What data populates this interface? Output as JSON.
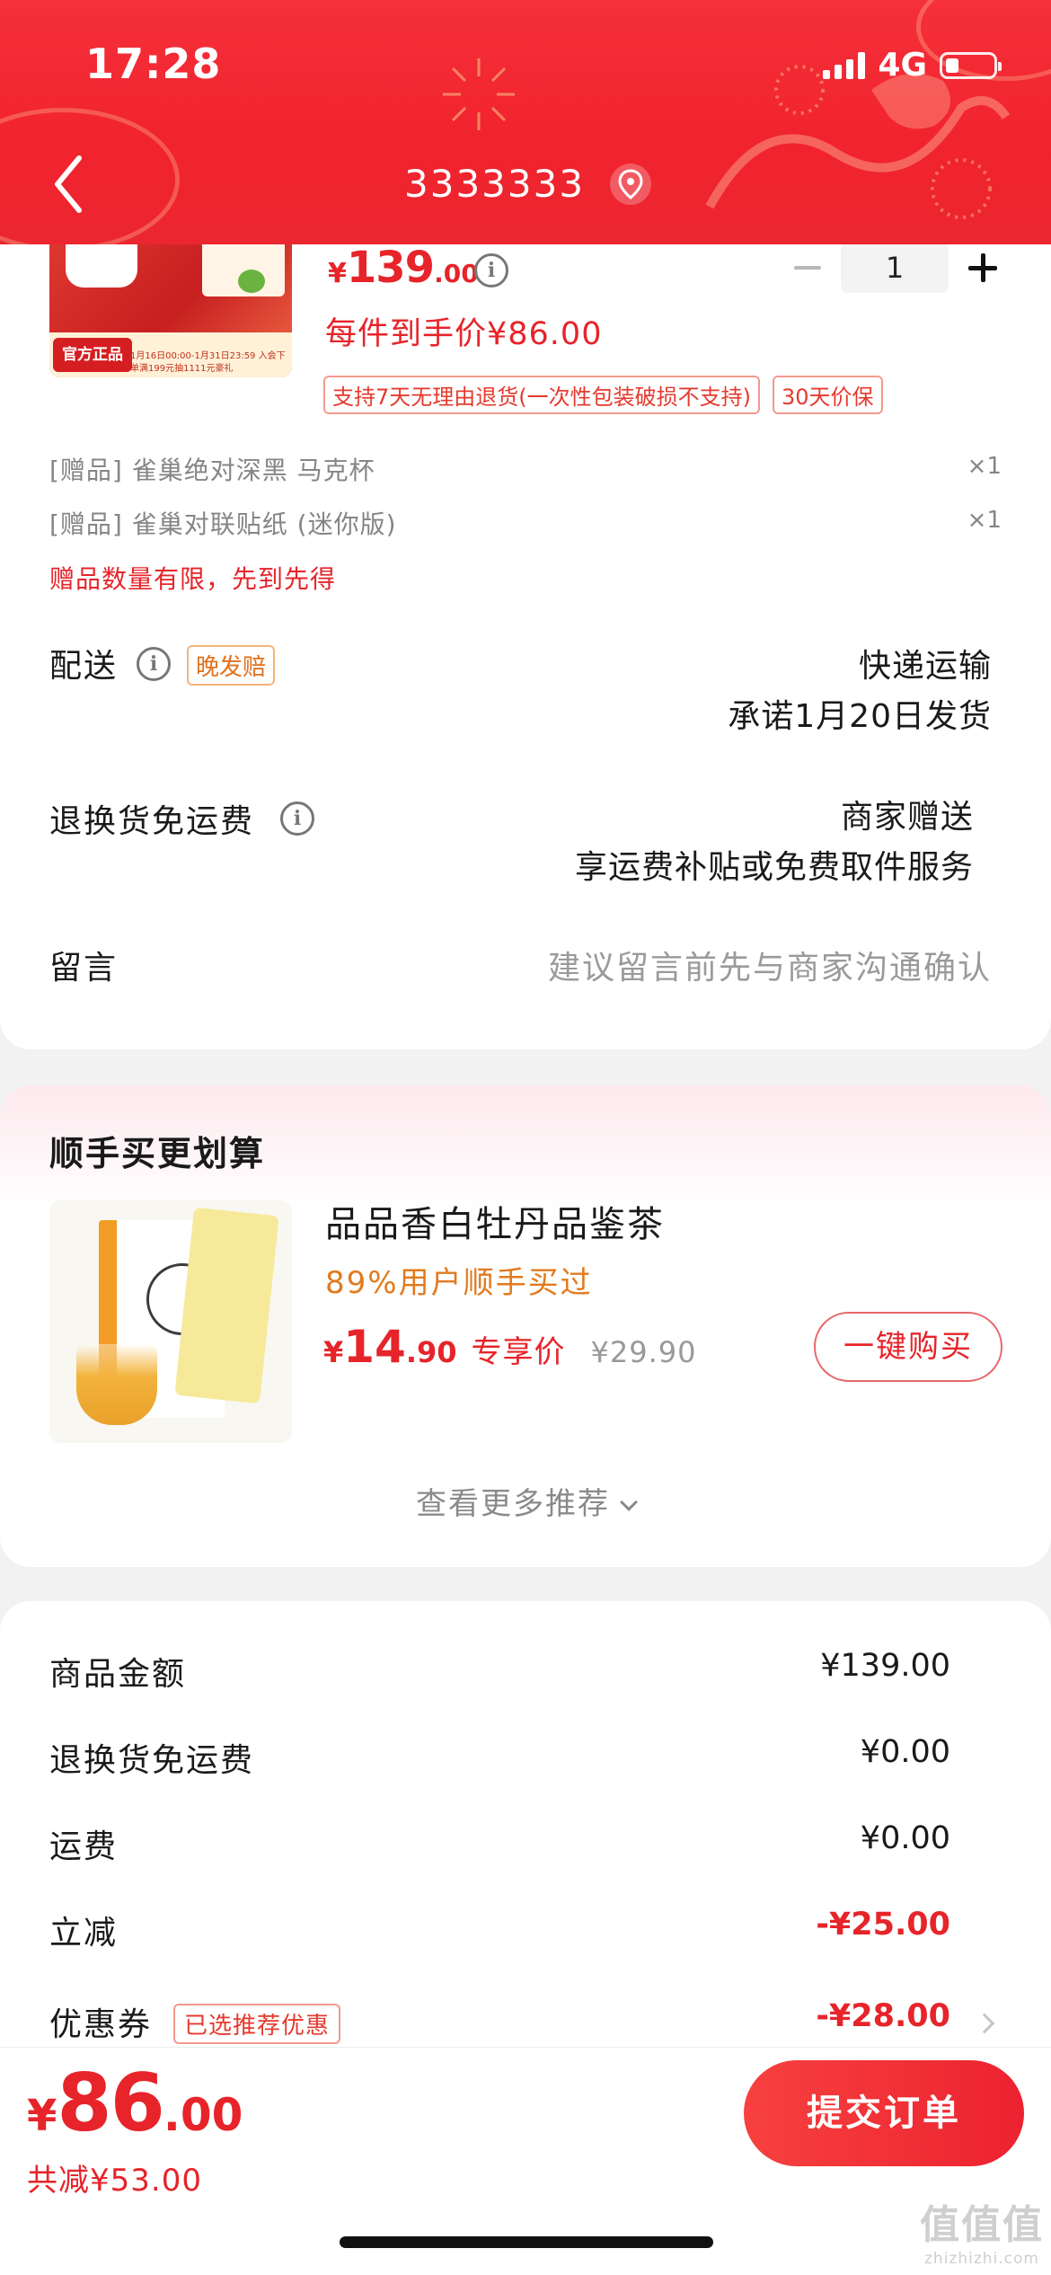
{
  "status_bar": {
    "time": "17:28",
    "network": "4G"
  },
  "nav": {
    "title": "3333333",
    "back_icon": "chevron-left-icon",
    "location_icon": "location-pin-icon"
  },
  "product": {
    "image_tag": "官方正品",
    "image_caption": "1月16日00:00-1月31日23:59  入会下单满199元抽1111元豪礼",
    "price_currency": "¥",
    "price_int": "139",
    "price_dec": ".00",
    "quantity": "1",
    "final_price_text": "每件到手价¥86.00",
    "badges": [
      "支持7天无理由退货(一次性包装破损不支持)",
      "30天价保"
    ]
  },
  "gifts": [
    {
      "label": "[赠品] 雀巢绝对深黑 马克杯",
      "qty": "×1"
    },
    {
      "label": "[赠品] 雀巢对联贴纸 (迷你版)",
      "qty": "×1"
    }
  ],
  "gift_note": "赠品数量有限，先到先得",
  "delivery": {
    "label": "配送",
    "tag": "晚发赔",
    "method": "快递运输",
    "promise": "承诺1月20日发货"
  },
  "return_shipping": {
    "label": "退换货免运费",
    "line1": "商家赠送",
    "line2": "享运费补贴或免费取件服务"
  },
  "message": {
    "label": "留言",
    "placeholder": "建议留言前先与商家沟通确认"
  },
  "recommend": {
    "title": "顺手买更划算",
    "name": "品品香白牡丹品鉴茶",
    "sub": "89%用户顺手买过",
    "price_currency": "¥",
    "price_int": "14",
    "price_dec": ".90",
    "price_label": "专享价",
    "original_price": "¥29.90",
    "buy_button": "一键购买",
    "more": "查看更多推荐"
  },
  "summary": {
    "rows": [
      {
        "label": "商品金额",
        "value": "¥139.00"
      },
      {
        "label": "退换货免运费",
        "value": "¥0.00"
      },
      {
        "label": "运费",
        "value": "¥0.00"
      },
      {
        "label": "立减",
        "value": "-¥25.00"
      },
      {
        "label": "优惠券",
        "value": "-¥28.00"
      }
    ],
    "coupon_tag": "已选推荐优惠"
  },
  "bottom": {
    "currency": "¥",
    "total_int": "86",
    "total_dec": ".00",
    "saved": "共减¥53.00",
    "submit": "提交订单"
  },
  "watermark": {
    "main": "值值值",
    "sub": "zhizhizhi.com"
  },
  "colors": {
    "brand_red": "#e6242a",
    "header_red": "#f0232e",
    "accent_orange": "#e27a1e"
  }
}
